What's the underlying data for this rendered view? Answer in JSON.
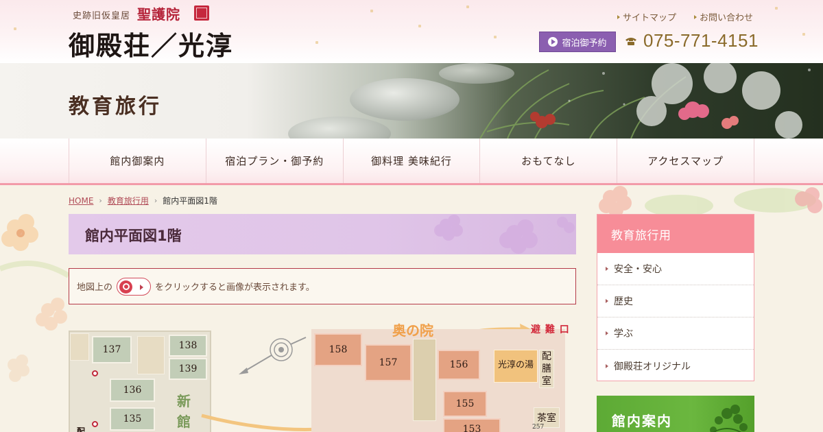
{
  "header": {
    "logo_sub": "史跡旧仮皇居",
    "logo_seal_name": "聖護院",
    "logo_main": "御殿荘／光淳",
    "util_links": [
      "サイトマップ",
      "お問い合わせ"
    ],
    "reserve_label": "宿泊御予約",
    "tel": "075-771-4151"
  },
  "hero": {
    "title": "教育旅行"
  },
  "nav": {
    "items": [
      "館内御案内",
      "宿泊プラン・御予約",
      "御料理 美味紀行",
      "おもてなし",
      "アクセスマップ"
    ]
  },
  "breadcrumb": {
    "home": "HOME",
    "parent": "教育旅行用",
    "current": "館内平面図1階"
  },
  "page": {
    "title": "館内平面図1階",
    "notice_before": "地図上の",
    "notice_after": "をクリックすると画像が表示されます。"
  },
  "map": {
    "rooms_new": [
      "137",
      "138",
      "139",
      "136",
      "135"
    ],
    "rooms_oku": [
      "158",
      "157",
      "156",
      "155",
      "153"
    ],
    "new_wing_label": "新館",
    "oku_label": "奥の院",
    "exit_label": "避 難 口",
    "bath_label": "光淳の湯",
    "serving_label": "配膳室",
    "tearoom_label": "茶室",
    "tearoom_no": "257",
    "corner_char": "配"
  },
  "sidebar": {
    "heading": "教育旅行用",
    "items": [
      "安全・安心",
      "歴史",
      "学ぶ",
      "御殿荘オリジナル"
    ],
    "banner": "館内案内"
  },
  "colors": {
    "accent_pink": "#f78d98",
    "title_purple": "#e3c9ea",
    "reserve_purple": "#8b5fb0",
    "nav_border": "#f29aa8",
    "green_banner": "#6bb73f"
  }
}
